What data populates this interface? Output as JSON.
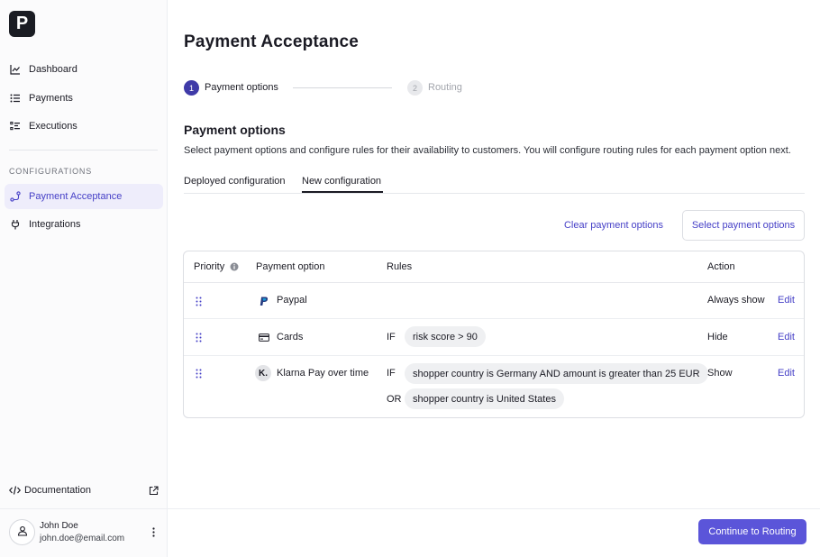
{
  "app": {
    "logo_letter": "P"
  },
  "sidebar": {
    "items": [
      {
        "label": "Dashboard",
        "icon": "chart-icon"
      },
      {
        "label": "Payments",
        "icon": "list-icon"
      },
      {
        "label": "Executions",
        "icon": "checklist-icon"
      }
    ],
    "section_title": "CONFIGURATIONS",
    "config_items": [
      {
        "label": "Payment Acceptance",
        "icon": "flow-icon",
        "active": true
      },
      {
        "label": "Integrations",
        "icon": "plug-icon",
        "active": false
      }
    ],
    "documentation": {
      "label": "Documentation",
      "icon": "code-icon",
      "ext_icon": "external-link-icon"
    },
    "user": {
      "name": "John Doe",
      "email": "john.doe@email.com"
    }
  },
  "page": {
    "title": "Payment Acceptance",
    "steps": [
      {
        "number": "1",
        "label": "Payment options",
        "active": true
      },
      {
        "number": "2",
        "label": "Routing",
        "active": false
      }
    ],
    "section": {
      "heading": "Payment options",
      "description": "Select payment options and configure rules for their availability to customers. You will configure routing rules for each payment option next."
    },
    "tabs": [
      {
        "label": "Deployed configuration",
        "active": false
      },
      {
        "label": "New configuration",
        "active": true
      }
    ],
    "actions": {
      "clear_label": "Clear payment options",
      "select_label": "Select payment options"
    },
    "table": {
      "headers": {
        "priority": "Priority",
        "option": "Payment option",
        "rules": "Rules",
        "action": "Action"
      },
      "rows": [
        {
          "option": "Paypal",
          "icon": "paypal-icon",
          "rules": [],
          "action": "Always show",
          "edit": "Edit"
        },
        {
          "option": "Cards",
          "icon": "card-icon",
          "rules": [
            {
              "op": "IF",
              "text": "risk score > 90"
            }
          ],
          "action": "Hide",
          "edit": "Edit"
        },
        {
          "option": "Klarna Pay over time",
          "icon": "klarna-icon",
          "icon_text": "K.",
          "rules": [
            {
              "op": "IF",
              "text": "shopper country is Germany AND amount is greater than 25 EUR"
            },
            {
              "op": "OR",
              "text": "shopper country is United States"
            }
          ],
          "action": "Show",
          "edit": "Edit"
        }
      ]
    },
    "footer": {
      "continue_label": "Continue to Routing"
    }
  },
  "colors": {
    "accent": "#4640c7",
    "primary_button": "#5b55d9",
    "active_nav_bg": "#eeedfb"
  }
}
